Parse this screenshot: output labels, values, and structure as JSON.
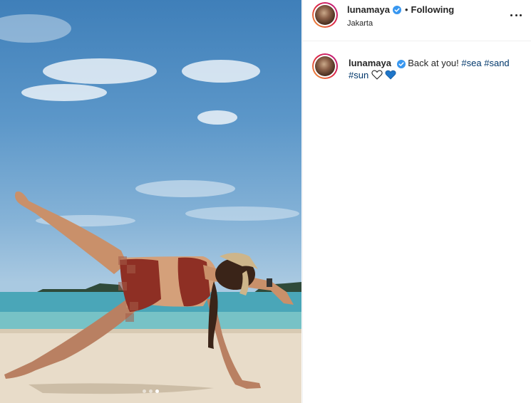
{
  "post": {
    "username": "lunamaya",
    "separator": "•",
    "follow_status": "Following",
    "location": "Jakarta",
    "carousel": {
      "count": 3,
      "active_index": 2
    }
  },
  "caption": {
    "username": "lunamaya",
    "text": "Back at you!",
    "hashtags": [
      "#sea",
      "#sand",
      "#sun"
    ],
    "emoji": [
      "white-heart",
      "blue-heart"
    ]
  },
  "colors": {
    "verified": "#3897f0",
    "hashtag": "#00376b",
    "blue_heart": "#1f76c9"
  },
  "icons": [
    "verified-badge-icon",
    "more-options-icon",
    "white-heart-icon",
    "blue-heart-icon"
  ]
}
